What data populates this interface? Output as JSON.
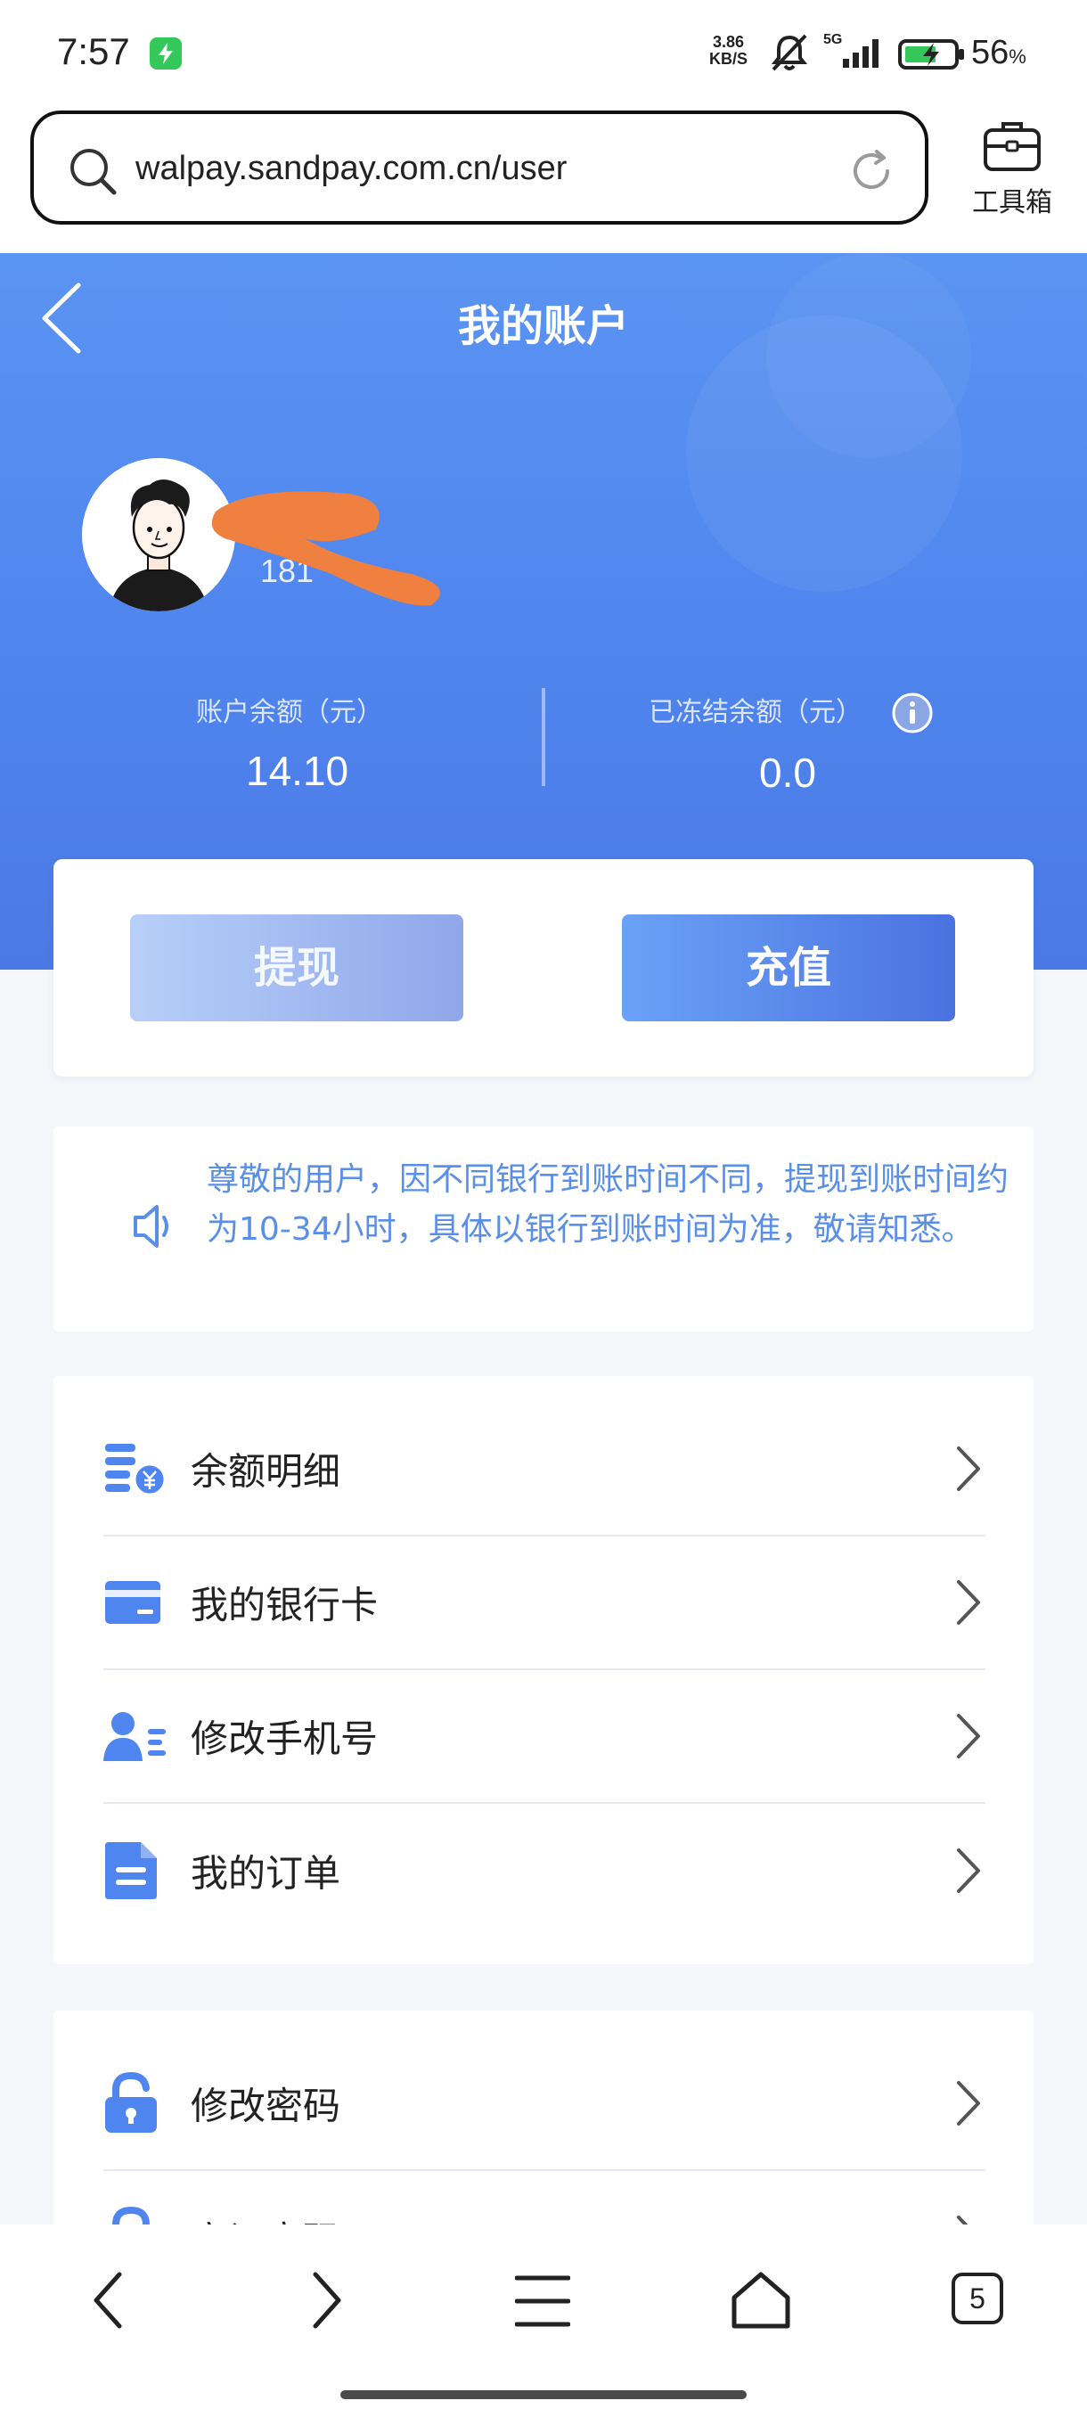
{
  "status_bar": {
    "time": "7:57",
    "net_speed_value": "3.86",
    "net_speed_unit": "KB/S",
    "network": "5G",
    "battery_percent": "56",
    "battery_unit": "%"
  },
  "browser": {
    "url": "walpay.sandpay.com.cn/user",
    "toolbox_label": "工具箱",
    "tabs_count": "5"
  },
  "header": {
    "title": "我的账户"
  },
  "user": {
    "phone_partial": "181"
  },
  "balances": {
    "account_label": "账户余额（元）",
    "account_value": "14.10",
    "frozen_label": "已冻结余额（元）",
    "frozen_value": "0.0"
  },
  "actions": {
    "withdraw_label": "提现",
    "recharge_label": "充值"
  },
  "notice": {
    "text": "尊敬的用户，因不同银行到账时间不同，提现到账时间约为10-34小时，具体以银行到账时间为准，敬请知悉。"
  },
  "menu_group_1": [
    {
      "label": "余额明细",
      "icon": "balance-detail-icon"
    },
    {
      "label": "我的银行卡",
      "icon": "bank-card-icon"
    },
    {
      "label": "修改手机号",
      "icon": "user-phone-icon"
    },
    {
      "label": "我的订单",
      "icon": "order-document-icon"
    }
  ],
  "menu_group_2": [
    {
      "label": "修改密码",
      "icon": "lock-icon"
    },
    {
      "label": "忘记密码",
      "icon": "lock-icon"
    }
  ],
  "colors": {
    "primary": "#4f85ee",
    "notice_text": "#5a8fe8",
    "icon_blue": "#4f85ee"
  }
}
